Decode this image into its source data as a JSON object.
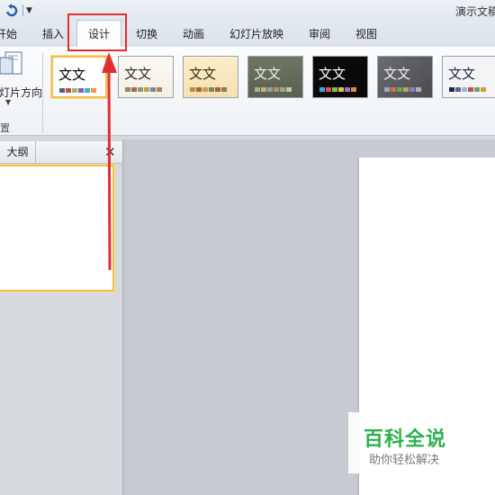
{
  "titlebar": {
    "title": "演示文稿"
  },
  "tabs": [
    {
      "label": "开始"
    },
    {
      "label": "插入"
    },
    {
      "label": "设计",
      "active": true
    },
    {
      "label": "切换"
    },
    {
      "label": "动画"
    },
    {
      "label": "幻灯片放映"
    },
    {
      "label": "审阅"
    },
    {
      "label": "视图"
    }
  ],
  "page_setup": {
    "orientation_label": "幻灯片方向",
    "group_label": "置"
  },
  "themes": {
    "sample_text": "文文",
    "items": [
      {
        "bg": "#ffffff",
        "text_color": "#000000",
        "swatches": [
          "#4a5f8a",
          "#c0504d",
          "#9bbb59",
          "#8064a2",
          "#4bacc6",
          "#f79646"
        ]
      },
      {
        "bg": "#f3f0e6",
        "text_color": "#2b2b2b",
        "swatches": [
          "#94856a",
          "#a36b5a",
          "#8aa06b",
          "#c2a04f",
          "#6d8ca8",
          "#b07f5f"
        ]
      },
      {
        "bg": "#f6e0b2",
        "text_color": "#3b2a10",
        "swatches": [
          "#c08a3c",
          "#9d6b3b",
          "#c2a050",
          "#7c8a4e",
          "#a55f4b",
          "#8f7a5c"
        ]
      },
      {
        "bg": "#6f7663",
        "text_color": "#f0f0e8",
        "swatches": [
          "#a8b08a",
          "#c7b27a",
          "#8ea0a8",
          "#b48c6e",
          "#9fa67c",
          "#d0c49a"
        ]
      },
      {
        "bg": "#0a0a0a",
        "text_color": "#ffffff",
        "swatches": [
          "#3fa0e0",
          "#e04f4f",
          "#7cc24f",
          "#e0c04f",
          "#9f6fd0",
          "#e08a3f"
        ]
      },
      {
        "bg": "#4a4c52",
        "text_color": "#f2f2f2",
        "swatches": [
          "#a0a8b8",
          "#d07050",
          "#70a060",
          "#c0a060",
          "#8080c0",
          "#b0b0b0"
        ]
      },
      {
        "bg": "#f4f4f6",
        "text_color": "#1f2b45",
        "swatches": [
          "#1f2b45",
          "#4f6a9a",
          "#a0b4d0",
          "#c05050",
          "#70a070",
          "#d0a040"
        ]
      }
    ]
  },
  "panel": {
    "outline_tab": "大纲",
    "close": "✕"
  },
  "watermark": {
    "title": "百科全说",
    "subtitle": "助你轻松解决"
  },
  "colors": {
    "highlight": "#e02f2f",
    "selection": "#f0c048",
    "brand_green": "#2bb24c"
  }
}
